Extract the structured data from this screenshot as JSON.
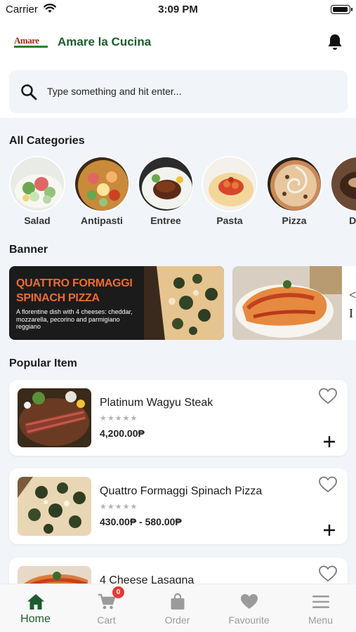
{
  "status_bar": {
    "carrier": "Carrier",
    "time": "3:09 PM"
  },
  "header": {
    "logo_text": "Amare",
    "title": "Amare la Cucina"
  },
  "search": {
    "placeholder": "Type something and hit enter..."
  },
  "sections": {
    "categories": "All Categories",
    "banner": "Banner",
    "popular": "Popular Item"
  },
  "categories": [
    {
      "label": "Salad"
    },
    {
      "label": "Antipasti"
    },
    {
      "label": "Entree"
    },
    {
      "label": "Pasta"
    },
    {
      "label": "Pizza"
    },
    {
      "label": "Des"
    }
  ],
  "banners": [
    {
      "title": "QUATTRO FORMAGGI SPINACH PIZZA",
      "description": "A florentine dish with 4 cheeses: cheddar, mozzarella, pecorino and parmigiano reggiano"
    },
    {
      "text_line1": "<",
      "text_line2": "I"
    }
  ],
  "popular_items": [
    {
      "name": "Platinum Wagyu Steak",
      "stars": "★★★★★",
      "price": "4,200.00₱"
    },
    {
      "name": "Quattro Formaggi Spinach Pizza",
      "stars": "★★★★★",
      "price": "430.00₱  - 580.00₱"
    },
    {
      "name": "4 Cheese Lasagna",
      "stars": "★★★★★",
      "price": ""
    }
  ],
  "tab_bar": {
    "tabs": [
      {
        "label": "Home",
        "icon": "home-icon"
      },
      {
        "label": "Cart",
        "icon": "cart-icon",
        "badge": "0"
      },
      {
        "label": "Order",
        "icon": "bag-icon"
      },
      {
        "label": "Favourite",
        "icon": "heart-icon"
      },
      {
        "label": "Menu",
        "icon": "menu-icon"
      }
    ]
  },
  "colors": {
    "brand_green": "#1d5c2e",
    "banner_orange": "#f26b2d",
    "badge_red": "#e53935",
    "background": "#f1f4f9"
  }
}
